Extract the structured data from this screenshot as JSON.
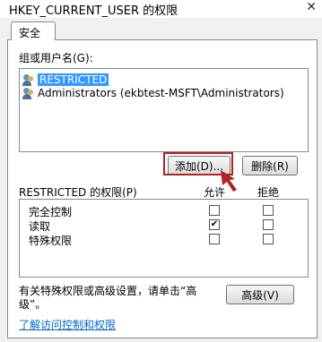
{
  "window": {
    "title": "HKEY_CURRENT_USER 的权限",
    "close_glyph": "✕"
  },
  "tabs": [
    {
      "label": "安全"
    }
  ],
  "group_label": "组或用户名(G):",
  "users": [
    {
      "name": "RESTRICTED",
      "selected": true
    },
    {
      "name": "Administrators (ekbtest-MSFT\\Administrators)",
      "selected": false
    }
  ],
  "buttons": {
    "add": "添加(D)...",
    "remove": "删除(R)",
    "advanced": "高级(V)"
  },
  "permissions": {
    "header": "RESTRICTED 的权限(P)",
    "allow_label": "允许",
    "deny_label": "拒绝",
    "rows": [
      {
        "name": "完全控制",
        "allow": false,
        "deny": false
      },
      {
        "name": "读取",
        "allow": true,
        "deny": false
      },
      {
        "name": "特殊权限",
        "allow": false,
        "deny": false
      }
    ]
  },
  "advanced_text_line1": "有关特殊权限或高级设置，请单击“高",
  "advanced_text_line2": "级”。",
  "help_link": "了解访问控制和权限",
  "check_glyph": "✔",
  "colors": {
    "selection": "#3399ff",
    "highlight_border": "#b22222",
    "link": "#0066cc"
  }
}
